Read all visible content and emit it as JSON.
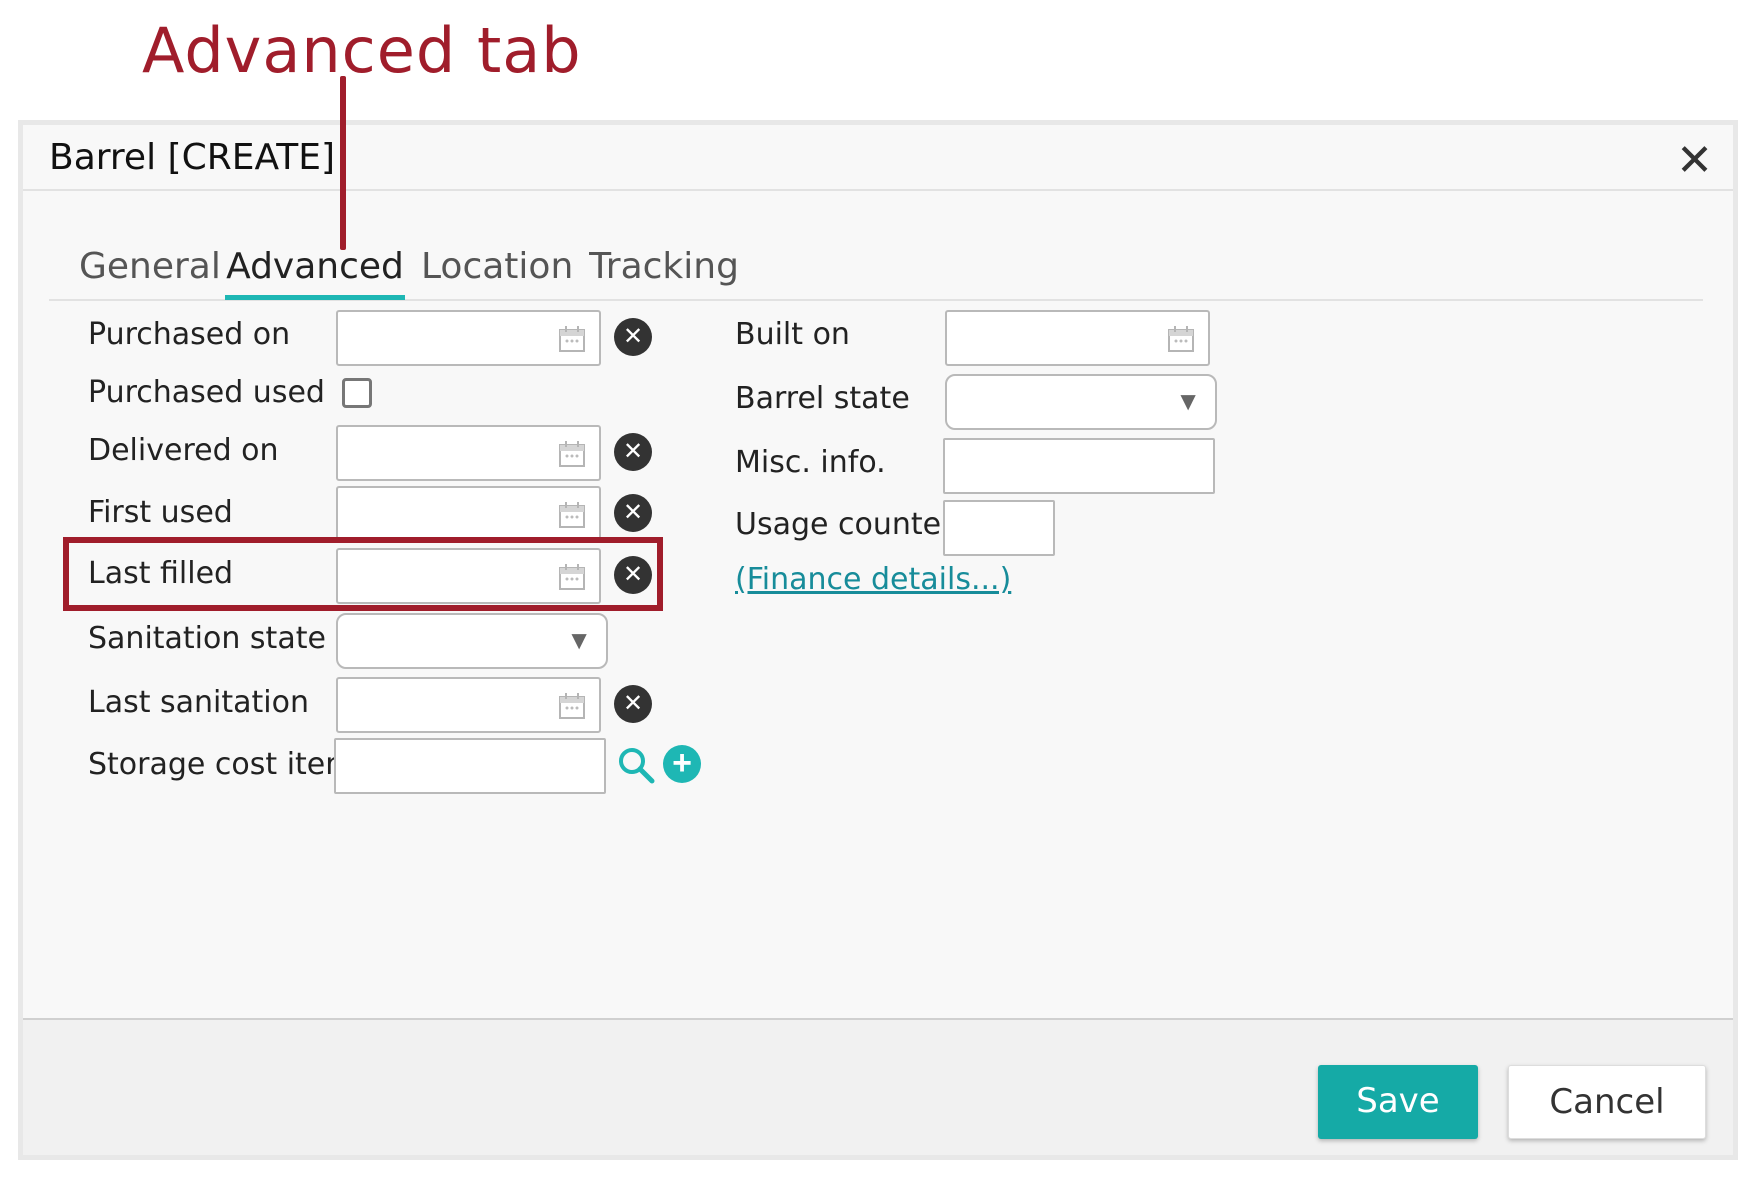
{
  "annotation": {
    "title": "Advanced tab",
    "color": "#a01d2b"
  },
  "dialog": {
    "title": "Barrel [CREATE]",
    "close_glyph": "✕",
    "tabs": [
      {
        "label": "General",
        "active": false
      },
      {
        "label": "Advanced",
        "active": true
      },
      {
        "label": "Location",
        "active": false
      },
      {
        "label": "Tracking",
        "active": false
      }
    ],
    "left_fields": {
      "purchased_on": {
        "label": "Purchased on",
        "value": "",
        "type": "date"
      },
      "purchased_used": {
        "label": "Purchased used",
        "checked": false,
        "type": "checkbox"
      },
      "delivered_on": {
        "label": "Delivered on",
        "value": "",
        "type": "date"
      },
      "first_used": {
        "label": "First used",
        "value": "",
        "type": "date"
      },
      "last_filled": {
        "label": "Last filled",
        "value": "",
        "type": "date",
        "highlighted": true
      },
      "sanitation_state": {
        "label": "Sanitation state",
        "value": "",
        "type": "select"
      },
      "last_sanitation": {
        "label": "Last sanitation",
        "value": "",
        "type": "date"
      },
      "storage_cost_item": {
        "label": "Storage cost item",
        "value": "",
        "type": "lookup"
      }
    },
    "right_fields": {
      "built_on": {
        "label": "Built on",
        "value": "",
        "type": "date"
      },
      "barrel_state": {
        "label": "Barrel state",
        "value": "",
        "type": "select"
      },
      "misc_info": {
        "label": "Misc. info.",
        "value": "",
        "type": "text"
      },
      "usage_counter": {
        "label": "Usage counter",
        "value": "",
        "type": "number"
      }
    },
    "finance_link": "(Finance details...)",
    "icons": {
      "calendar": "calendar-icon",
      "clear": "clear-icon",
      "search": "search-icon",
      "add": "plus-circle-icon",
      "dropdown": "chevron-down-icon"
    },
    "clear_glyph": "✕",
    "plus_glyph": "+",
    "caret_glyph": "▼",
    "footer": {
      "save_label": "Save",
      "cancel_label": "Cancel"
    },
    "colors": {
      "accent": "#1eb7b4",
      "save_bg": "#15aaa6",
      "link": "#178c9a",
      "highlight": "#a01d2b"
    }
  }
}
